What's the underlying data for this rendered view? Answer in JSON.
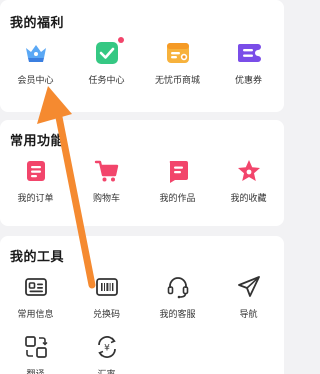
{
  "welfare": {
    "title": "我的福利",
    "items": [
      {
        "label": "会员中心",
        "icon": "crown-icon"
      },
      {
        "label": "任务中心",
        "icon": "task-check-icon"
      },
      {
        "label": "无忧币商城",
        "icon": "coin-store-icon"
      },
      {
        "label": "优惠券",
        "icon": "coupon-icon"
      }
    ]
  },
  "common": {
    "title": "常用功能",
    "items": [
      {
        "label": "我的订单",
        "icon": "order-icon"
      },
      {
        "label": "购物车",
        "icon": "cart-icon"
      },
      {
        "label": "我的作品",
        "icon": "works-icon"
      },
      {
        "label": "我的收藏",
        "icon": "star-icon"
      }
    ]
  },
  "tools": {
    "title": "我的工具",
    "items": [
      {
        "label": "常用信息",
        "icon": "id-card-icon"
      },
      {
        "label": "兑换码",
        "icon": "barcode-icon"
      },
      {
        "label": "我的客服",
        "icon": "headset-icon"
      },
      {
        "label": "导航",
        "icon": "paper-plane-icon"
      },
      {
        "label": "翻译",
        "icon": "translate-icon"
      },
      {
        "label": "汇率",
        "icon": "exchange-rate-icon"
      }
    ]
  },
  "colors": {
    "accent_pink": "#f2456b",
    "accent_purple": "#7a4de8",
    "accent_green": "#2fc27a",
    "accent_orange": "#f7a738",
    "arrow_orange": "#f58a30"
  }
}
